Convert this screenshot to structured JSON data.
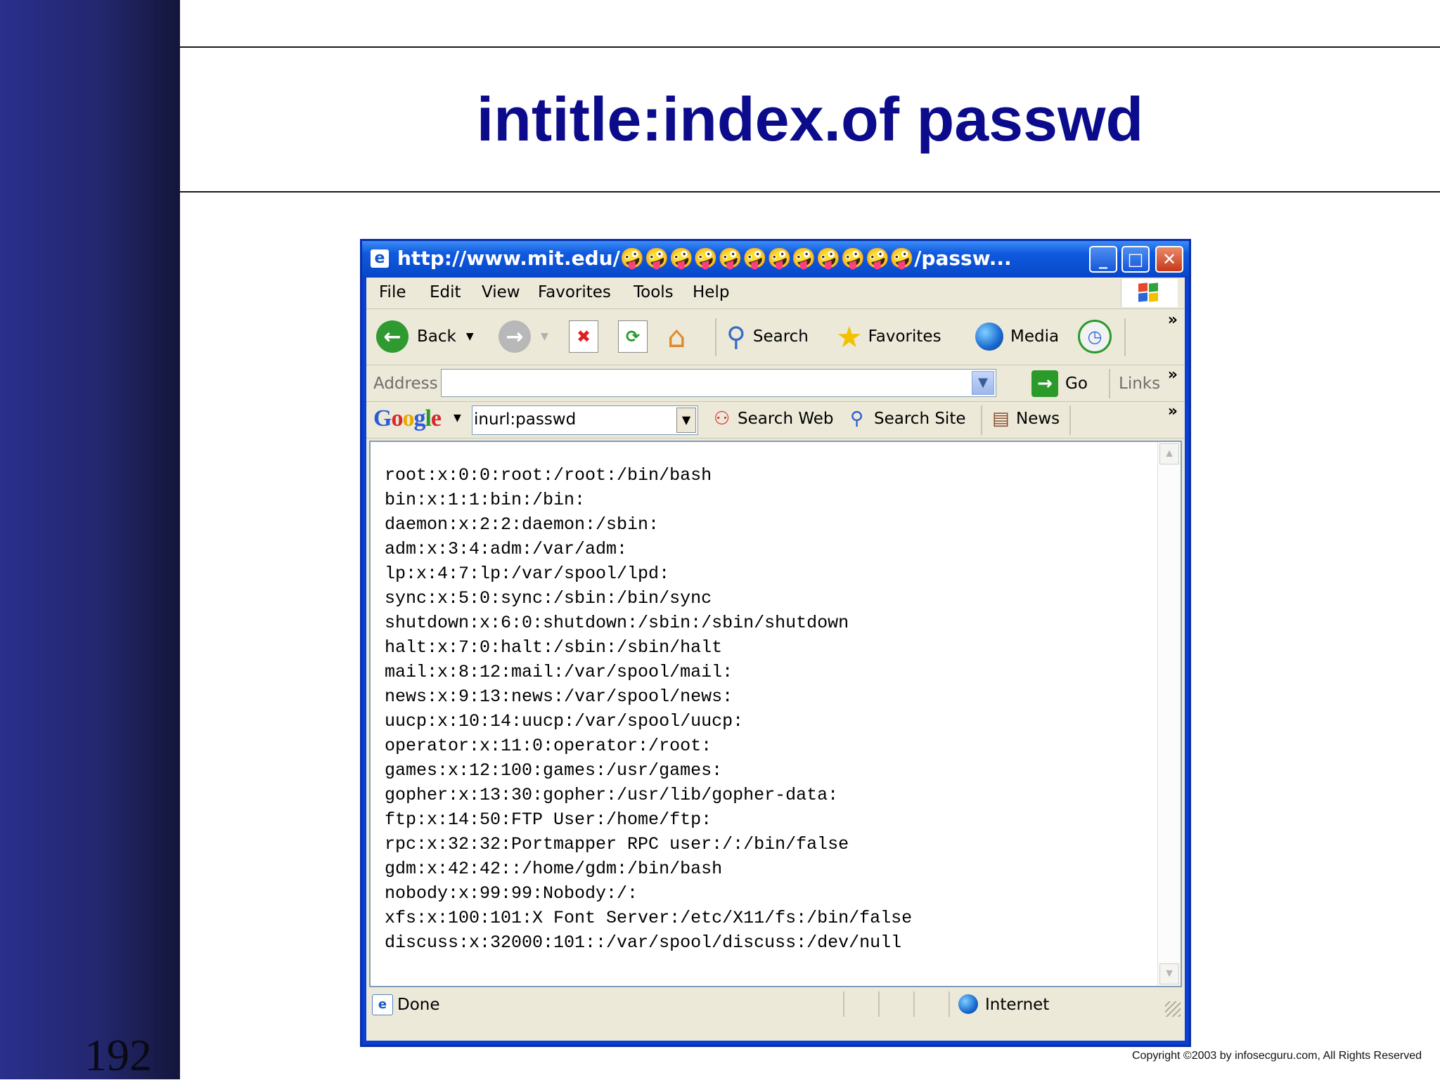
{
  "slide": {
    "title": "intitle:index.of passwd",
    "number": "192",
    "copyright": "Copyright  ©2003 by infosecguru.com, All Rights Reserved"
  },
  "browser": {
    "window_title": "http://www.mit.edu/🤪🤪🤪🤪🤪🤪🤪🤪🤪🤪🤪🤪/passw...",
    "menu": [
      "File",
      "Edit",
      "View",
      "Favorites",
      "Tools",
      "Help"
    ],
    "toolbar": {
      "back": "Back",
      "search": "Search",
      "favorites": "Favorites",
      "media": "Media",
      "more": "»"
    },
    "address": {
      "label": "Address",
      "value": "",
      "go": "Go",
      "links": "Links"
    },
    "google_bar": {
      "logo": "Google",
      "query": "inurl:passwd",
      "search_web": "Search Web",
      "search_site": "Search Site",
      "news": "News"
    },
    "content_lines": [
      "root:x:0:0:root:/root:/bin/bash",
      "bin:x:1:1:bin:/bin:",
      "daemon:x:2:2:daemon:/sbin:",
      "adm:x:3:4:adm:/var/adm:",
      "lp:x:4:7:lp:/var/spool/lpd:",
      "sync:x:5:0:sync:/sbin:/bin/sync",
      "shutdown:x:6:0:shutdown:/sbin:/sbin/shutdown",
      "halt:x:7:0:halt:/sbin:/sbin/halt",
      "mail:x:8:12:mail:/var/spool/mail:",
      "news:x:9:13:news:/var/spool/news:",
      "uucp:x:10:14:uucp:/var/spool/uucp:",
      "operator:x:11:0:operator:/root:",
      "games:x:12:100:games:/usr/games:",
      "gopher:x:13:30:gopher:/usr/lib/gopher-data:",
      "ftp:x:14:50:FTP User:/home/ftp:",
      "rpc:x:32:32:Portmapper RPC user:/:/bin/false",
      "gdm:x:42:42::/home/gdm:/bin/bash",
      "nobody:x:99:99:Nobody:/:",
      "xfs:x:100:101:X Font Server:/etc/X11/fs:/bin/false",
      "discuss:x:32000:101::/var/spool/discuss:/dev/null"
    ],
    "status": {
      "text": "Done",
      "zone": "Internet"
    }
  },
  "colors": {
    "title": "#0b0b8c",
    "sidebar": "#23276e",
    "window_frame": "#0a3fd0"
  }
}
